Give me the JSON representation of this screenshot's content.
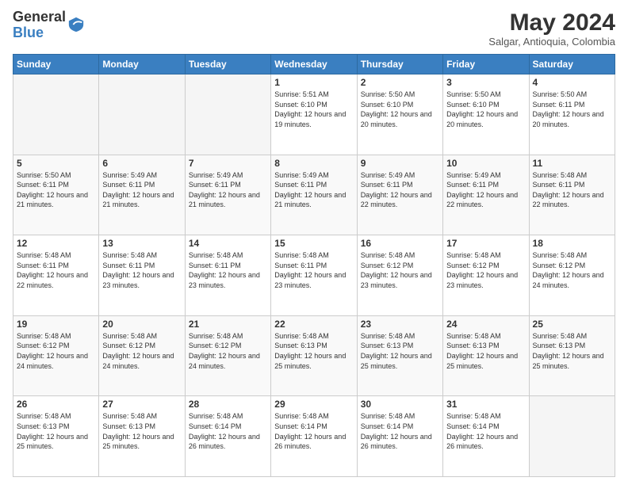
{
  "logo": {
    "general": "General",
    "blue": "Blue"
  },
  "header": {
    "month_year": "May 2024",
    "location": "Salgar, Antioquia, Colombia"
  },
  "weekdays": [
    "Sunday",
    "Monday",
    "Tuesday",
    "Wednesday",
    "Thursday",
    "Friday",
    "Saturday"
  ],
  "weeks": [
    [
      {
        "day": "",
        "info": ""
      },
      {
        "day": "",
        "info": ""
      },
      {
        "day": "",
        "info": ""
      },
      {
        "day": "1",
        "info": "Sunrise: 5:51 AM\nSunset: 6:10 PM\nDaylight: 12 hours and 19 minutes."
      },
      {
        "day": "2",
        "info": "Sunrise: 5:50 AM\nSunset: 6:10 PM\nDaylight: 12 hours and 20 minutes."
      },
      {
        "day": "3",
        "info": "Sunrise: 5:50 AM\nSunset: 6:10 PM\nDaylight: 12 hours and 20 minutes."
      },
      {
        "day": "4",
        "info": "Sunrise: 5:50 AM\nSunset: 6:11 PM\nDaylight: 12 hours and 20 minutes."
      }
    ],
    [
      {
        "day": "5",
        "info": "Sunrise: 5:50 AM\nSunset: 6:11 PM\nDaylight: 12 hours and 21 minutes."
      },
      {
        "day": "6",
        "info": "Sunrise: 5:49 AM\nSunset: 6:11 PM\nDaylight: 12 hours and 21 minutes."
      },
      {
        "day": "7",
        "info": "Sunrise: 5:49 AM\nSunset: 6:11 PM\nDaylight: 12 hours and 21 minutes."
      },
      {
        "day": "8",
        "info": "Sunrise: 5:49 AM\nSunset: 6:11 PM\nDaylight: 12 hours and 21 minutes."
      },
      {
        "day": "9",
        "info": "Sunrise: 5:49 AM\nSunset: 6:11 PM\nDaylight: 12 hours and 22 minutes."
      },
      {
        "day": "10",
        "info": "Sunrise: 5:49 AM\nSunset: 6:11 PM\nDaylight: 12 hours and 22 minutes."
      },
      {
        "day": "11",
        "info": "Sunrise: 5:48 AM\nSunset: 6:11 PM\nDaylight: 12 hours and 22 minutes."
      }
    ],
    [
      {
        "day": "12",
        "info": "Sunrise: 5:48 AM\nSunset: 6:11 PM\nDaylight: 12 hours and 22 minutes."
      },
      {
        "day": "13",
        "info": "Sunrise: 5:48 AM\nSunset: 6:11 PM\nDaylight: 12 hours and 23 minutes."
      },
      {
        "day": "14",
        "info": "Sunrise: 5:48 AM\nSunset: 6:11 PM\nDaylight: 12 hours and 23 minutes."
      },
      {
        "day": "15",
        "info": "Sunrise: 5:48 AM\nSunset: 6:11 PM\nDaylight: 12 hours and 23 minutes."
      },
      {
        "day": "16",
        "info": "Sunrise: 5:48 AM\nSunset: 6:12 PM\nDaylight: 12 hours and 23 minutes."
      },
      {
        "day": "17",
        "info": "Sunrise: 5:48 AM\nSunset: 6:12 PM\nDaylight: 12 hours and 23 minutes."
      },
      {
        "day": "18",
        "info": "Sunrise: 5:48 AM\nSunset: 6:12 PM\nDaylight: 12 hours and 24 minutes."
      }
    ],
    [
      {
        "day": "19",
        "info": "Sunrise: 5:48 AM\nSunset: 6:12 PM\nDaylight: 12 hours and 24 minutes."
      },
      {
        "day": "20",
        "info": "Sunrise: 5:48 AM\nSunset: 6:12 PM\nDaylight: 12 hours and 24 minutes."
      },
      {
        "day": "21",
        "info": "Sunrise: 5:48 AM\nSunset: 6:12 PM\nDaylight: 12 hours and 24 minutes."
      },
      {
        "day": "22",
        "info": "Sunrise: 5:48 AM\nSunset: 6:13 PM\nDaylight: 12 hours and 25 minutes."
      },
      {
        "day": "23",
        "info": "Sunrise: 5:48 AM\nSunset: 6:13 PM\nDaylight: 12 hours and 25 minutes."
      },
      {
        "day": "24",
        "info": "Sunrise: 5:48 AM\nSunset: 6:13 PM\nDaylight: 12 hours and 25 minutes."
      },
      {
        "day": "25",
        "info": "Sunrise: 5:48 AM\nSunset: 6:13 PM\nDaylight: 12 hours and 25 minutes."
      }
    ],
    [
      {
        "day": "26",
        "info": "Sunrise: 5:48 AM\nSunset: 6:13 PM\nDaylight: 12 hours and 25 minutes."
      },
      {
        "day": "27",
        "info": "Sunrise: 5:48 AM\nSunset: 6:13 PM\nDaylight: 12 hours and 25 minutes."
      },
      {
        "day": "28",
        "info": "Sunrise: 5:48 AM\nSunset: 6:14 PM\nDaylight: 12 hours and 26 minutes."
      },
      {
        "day": "29",
        "info": "Sunrise: 5:48 AM\nSunset: 6:14 PM\nDaylight: 12 hours and 26 minutes."
      },
      {
        "day": "30",
        "info": "Sunrise: 5:48 AM\nSunset: 6:14 PM\nDaylight: 12 hours and 26 minutes."
      },
      {
        "day": "31",
        "info": "Sunrise: 5:48 AM\nSunset: 6:14 PM\nDaylight: 12 hours and 26 minutes."
      },
      {
        "day": "",
        "info": ""
      }
    ]
  ]
}
